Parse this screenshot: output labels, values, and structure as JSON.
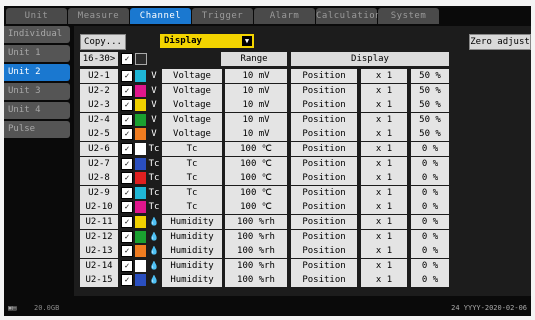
{
  "tabs": [
    {
      "label": "Unit",
      "active": false
    },
    {
      "label": "Measure",
      "active": false
    },
    {
      "label": "Channel",
      "active": true
    },
    {
      "label": "Trigger",
      "active": false
    },
    {
      "label": "Alarm",
      "active": false
    },
    {
      "label": "Calculation",
      "active": false
    },
    {
      "label": "System",
      "active": false
    }
  ],
  "sidebar": [
    {
      "label": "Individual",
      "active": false
    },
    {
      "label": "Unit 1",
      "active": false
    },
    {
      "label": "Unit 2",
      "active": true
    },
    {
      "label": "Unit 3",
      "active": false
    },
    {
      "label": "Unit 4",
      "active": false
    },
    {
      "label": "Pulse",
      "active": false
    }
  ],
  "toolbar": {
    "copy_label": "Copy...",
    "view_label": "Display",
    "zero_adjust_label": "Zero adjust"
  },
  "range_header": "16-30>",
  "columns": {
    "range": "Range",
    "display": "Display"
  },
  "rows": [
    {
      "ch": "U2-1",
      "color": "#1fb6d6",
      "type": "V",
      "input": "Voltage",
      "range": "10 mV",
      "mode": "Position",
      "scale": "x 1",
      "value": "50 %"
    },
    {
      "ch": "U2-2",
      "color": "#e0168c",
      "type": "V",
      "input": "Voltage",
      "range": "10 mV",
      "mode": "Position",
      "scale": "x 1",
      "value": "50 %"
    },
    {
      "ch": "U2-3",
      "color": "#f0d000",
      "type": "V",
      "input": "Voltage",
      "range": "10 mV",
      "mode": "Position",
      "scale": "x 1",
      "value": "50 %"
    },
    {
      "ch": "U2-4",
      "color": "#1aa030",
      "type": "V",
      "input": "Voltage",
      "range": "10 mV",
      "mode": "Position",
      "scale": "x 1",
      "value": "50 %"
    },
    {
      "ch": "U2-5",
      "color": "#f07c20",
      "type": "V",
      "input": "Voltage",
      "range": "10 mV",
      "mode": "Position",
      "scale": "x 1",
      "value": "50 %"
    },
    {
      "ch": "U2-6",
      "color": "#ffffff",
      "type": "Tc",
      "input": "Tc",
      "range": "100 ℃",
      "mode": "Position",
      "scale": "x 1",
      "value": "0 %"
    },
    {
      "ch": "U2-7",
      "color": "#2a4fc0",
      "type": "Tc",
      "input": "Tc",
      "range": "100 ℃",
      "mode": "Position",
      "scale": "x 1",
      "value": "0 %"
    },
    {
      "ch": "U2-8",
      "color": "#e02020",
      "type": "Tc",
      "input": "Tc",
      "range": "100 ℃",
      "mode": "Position",
      "scale": "x 1",
      "value": "0 %"
    },
    {
      "ch": "U2-9",
      "color": "#1fb6d6",
      "type": "Tc",
      "input": "Tc",
      "range": "100 ℃",
      "mode": "Position",
      "scale": "x 1",
      "value": "0 %"
    },
    {
      "ch": "U2-10",
      "color": "#e0168c",
      "type": "Tc",
      "input": "Tc",
      "range": "100 ℃",
      "mode": "Position",
      "scale": "x 1",
      "value": "0 %"
    },
    {
      "ch": "U2-11",
      "color": "#f0d000",
      "type": "H",
      "input": "Humidity",
      "range": "100 %rh",
      "mode": "Position",
      "scale": "x 1",
      "value": "0 %"
    },
    {
      "ch": "U2-12",
      "color": "#1aa030",
      "type": "H",
      "input": "Humidity",
      "range": "100 %rh",
      "mode": "Position",
      "scale": "x 1",
      "value": "0 %"
    },
    {
      "ch": "U2-13",
      "color": "#f07c20",
      "type": "H",
      "input": "Humidity",
      "range": "100 %rh",
      "mode": "Position",
      "scale": "x 1",
      "value": "0 %"
    },
    {
      "ch": "U2-14",
      "color": "#ffffff",
      "type": "H",
      "input": "Humidity",
      "range": "100 %rh",
      "mode": "Position",
      "scale": "x 1",
      "value": "0 %"
    },
    {
      "ch": "U2-15",
      "color": "#2a4fc0",
      "type": "H",
      "input": "Humidity",
      "range": "100 %rh",
      "mode": "Position",
      "scale": "x 1",
      "value": "0 %"
    }
  ],
  "status": {
    "zoom": "20.0GB",
    "datetime": "24 YYYY-2020-02-06"
  }
}
